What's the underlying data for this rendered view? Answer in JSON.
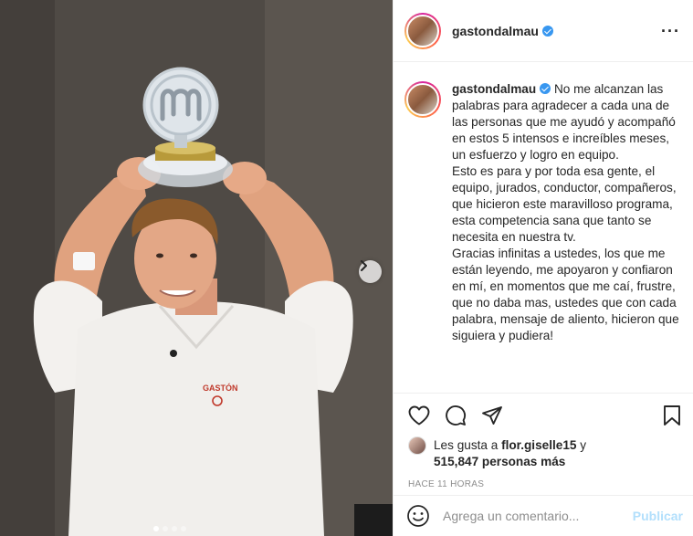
{
  "post": {
    "username": "gastondalmau",
    "verified": true,
    "more_icon": "more-horizontal-icon",
    "caption_paragraphs": [
      "No me alcanzan las palabras para agradecer a cada una de las personas que me ayudó y acompañó en estos 5 intensos e increíbles meses, un esfuerzo y logro en equipo.",
      "Esto es para y por toda esa gente, el equipo, jurados, conductor, compañeros, que hicieron este maravilloso programa, esta competencia sana que tanto se necesita en nuestra tv.",
      "Gracias infinitas a ustedes, los que me están leyendo, me apoyaron y confiaron en mí, en momentos que me caí, frustre, que no daba mas, ustedes que con cada palabra, mensaje de aliento, hicieron que siguiera y pudiera!"
    ],
    "chef_jacket_text": "GASTÓN",
    "carousel": {
      "total_slides": 4,
      "active_slide": 1
    }
  },
  "actions": {
    "like_icon": "heart-icon",
    "comment_icon": "comment-icon",
    "share_icon": "paper-plane-icon",
    "save_icon": "bookmark-icon"
  },
  "likes": {
    "prefix": "Les gusta a",
    "first_user": "flor.giselle15",
    "connector": "y",
    "others_count": "515,847 personas más"
  },
  "timestamp": "HACE 11 HORAS",
  "comment": {
    "placeholder": "Agrega un comentario...",
    "publish_label": "Publicar",
    "emoji_icon": "smiley-icon"
  },
  "colors": {
    "verified_blue": "#3897f0",
    "publish_disabled": "#b2dffc",
    "muted_text": "#8e8e8e",
    "border": "#efefef"
  }
}
